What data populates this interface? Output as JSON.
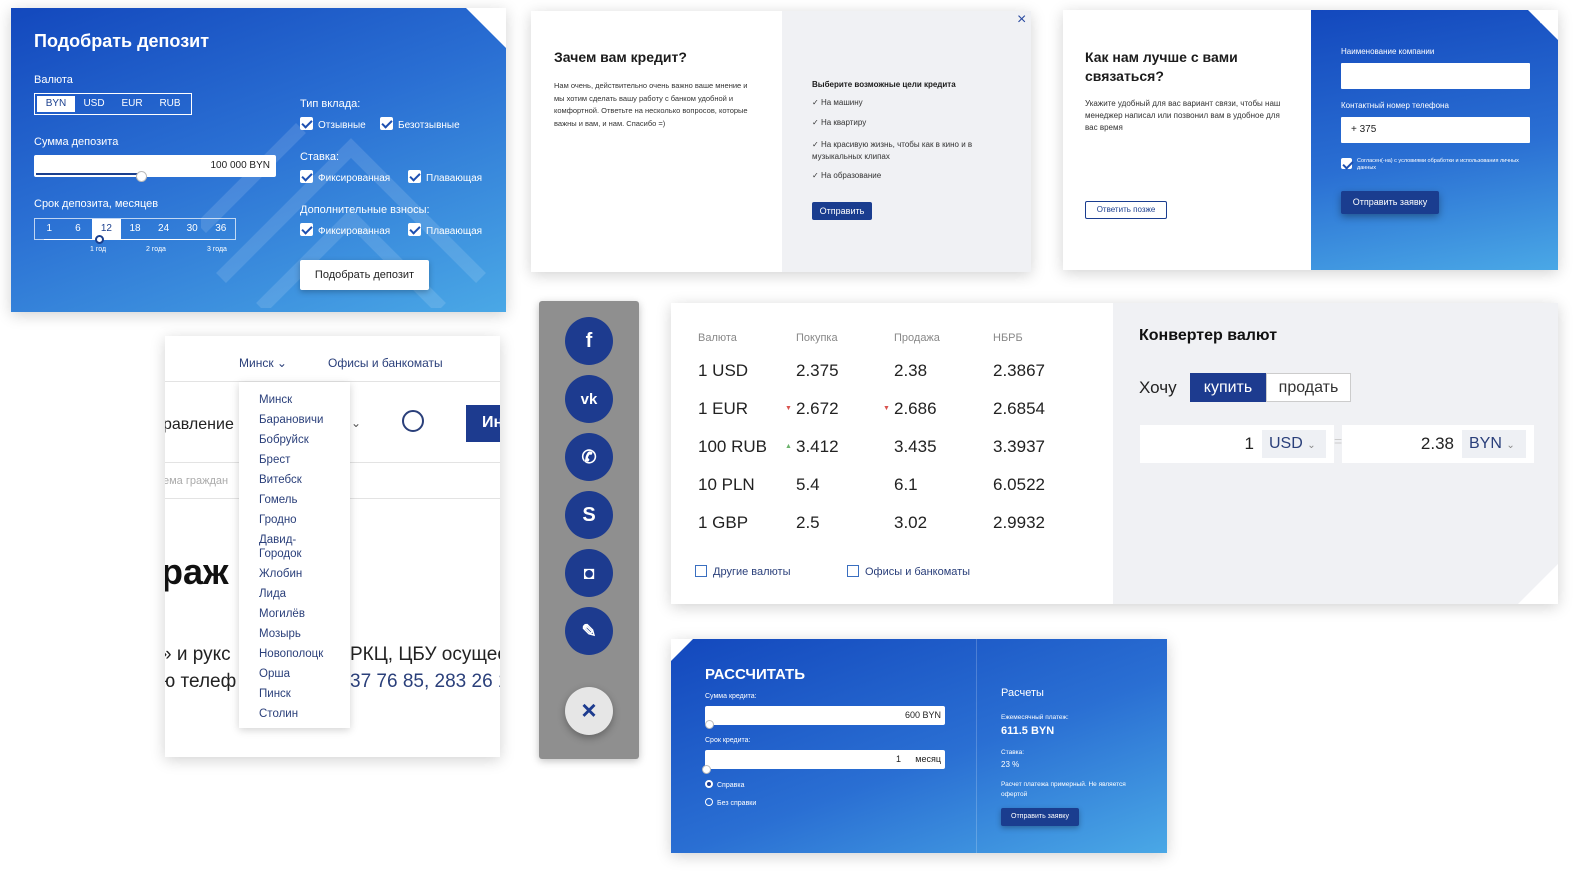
{
  "deposit": {
    "title": "Подобрать депозит",
    "currency_label": "Валюта",
    "currencies": [
      "BYN",
      "USD",
      "EUR",
      "RUB"
    ],
    "currency_selected": "BYN",
    "amount_label": "Сумма депозита",
    "amount_value": "100 000 BYN",
    "term_label": "Срок депозита, месяцев",
    "terms": [
      "1",
      "6",
      "12",
      "18",
      "24",
      "30",
      "36"
    ],
    "term_selected": "12",
    "term_marks": [
      "1 год",
      "2 года",
      "3 года"
    ],
    "type_label": "Тип вклада:",
    "type_options": [
      "Отзывные",
      "Безотзывные"
    ],
    "rate_label": "Ставка:",
    "rate_options": [
      "Фиксированная",
      "Плавающая"
    ],
    "extra_label": "Дополнительные взносы:",
    "extra_options": [
      "Фиксированная",
      "Плавающая"
    ],
    "submit": "Подобрать депозит"
  },
  "credit_popup": {
    "title": "Зачем вам кредит?",
    "text": "Нам очень, действительно очень важно ваше мнение и мы хотим сделать вашу работу с банком удобной и комфортной. Ответьте на несколько вопросов, которые важны и вам, и нам. Спасибо =)",
    "goals_title": "Выберите возможные цели кредита",
    "goals": [
      "На машину",
      "На квартиру",
      "На красивую жизнь, чтобы как в кино и в музыкальных клипах",
      "На образование"
    ],
    "submit": "Отправить",
    "close": "×"
  },
  "contact_popup": {
    "title": "Как нам лучше с вами связаться?",
    "text": "Укажите удобный для вас вариант связи, чтобы наш менеджер написал или позвонил вам в удобное для вас время",
    "later": "Ответить позже",
    "company_label": "Наименование компании",
    "company_value": "",
    "phone_label": "Контактный номер телефона",
    "phone_value": "+ 375",
    "consent": "Согласен(-на) с условиями обработки и использования личных данных",
    "submit": "Отправить заявку",
    "close": "×"
  },
  "city_menu": {
    "selected": "Минск",
    "offices_link": "Офисы и банкоматы",
    "bg_text_1": "равление",
    "bg_button": "Ин",
    "bg_text_2": "ема граждан",
    "bg_heading": "раж",
    "bg_line_1": "» и рукс",
    "bg_line_1b": "РКЦ, ЦБУ осущес",
    "bg_line_2": "ю телеф",
    "bg_line_2b": "37 76 85, 283 26 1",
    "cities": [
      "Минск",
      "Барановичи",
      "Бобруйск",
      "Брест",
      "Витебск",
      "Гомель",
      "Гродно",
      "Давид-Городок",
      "Жлобин",
      "Лида",
      "Могилёв",
      "Мозырь",
      "Новополоцк",
      "Орша",
      "Пинск",
      "Столин"
    ]
  },
  "social": {
    "icons": [
      "facebook-icon",
      "vk-icon",
      "viber-icon",
      "skype-icon",
      "instagram-icon",
      "chat-icon"
    ],
    "glyphs": [
      "f",
      "vk",
      "✆",
      "S",
      "◘",
      "✎"
    ],
    "close": "×"
  },
  "rates": {
    "headers": [
      "Валюта",
      "Покупка",
      "Продажа",
      "НБРБ"
    ],
    "rows": [
      {
        "cur": "1 USD",
        "buy": "2.375",
        "sell": "2.38",
        "nb": "2.3867",
        "buy_trend": "",
        "sell_trend": ""
      },
      {
        "cur": "1 EUR",
        "buy": "2.672",
        "sell": "2.686",
        "nb": "2.6854",
        "buy_trend": "down",
        "sell_trend": "down"
      },
      {
        "cur": "100 RUB",
        "buy": "3.412",
        "sell": "3.435",
        "nb": "3.3937",
        "buy_trend": "up",
        "sell_trend": ""
      },
      {
        "cur": "10 PLN",
        "buy": "5.4",
        "sell": "6.1",
        "nb": "6.0522",
        "buy_trend": "",
        "sell_trend": ""
      },
      {
        "cur": "1 GBP",
        "buy": "2.5",
        "sell": "3.02",
        "nb": "2.9932",
        "buy_trend": "",
        "sell_trend": ""
      }
    ],
    "other_link": "Другие валюты",
    "offices_link": "Офисы и банкоматы",
    "converter_title": "Конвертер валют",
    "want": "Хочу",
    "buy": "купить",
    "sell": "продать",
    "from_amount": "1",
    "from_cur": "USD",
    "eq": "=",
    "to_amount": "2.38",
    "to_cur": "BYN"
  },
  "calc": {
    "title": "РАССЧИТАТЬ",
    "sum_label": "Сумма кредита:",
    "sum_value": "600 BYN",
    "term_label": "Срок кредита:",
    "term_value": "1",
    "term_unit": "месяц",
    "radio_1": "Справка",
    "radio_2": "Без справки",
    "results_title": "Расчеты",
    "payment_label": "Ежемесячный платеж:",
    "payment_value": "611.5 BYN",
    "rate_label": "Ставка:",
    "rate_value": "23 %",
    "note": "Расчет платежа примерный. Не является офертой",
    "submit": "Отправить заявку"
  }
}
